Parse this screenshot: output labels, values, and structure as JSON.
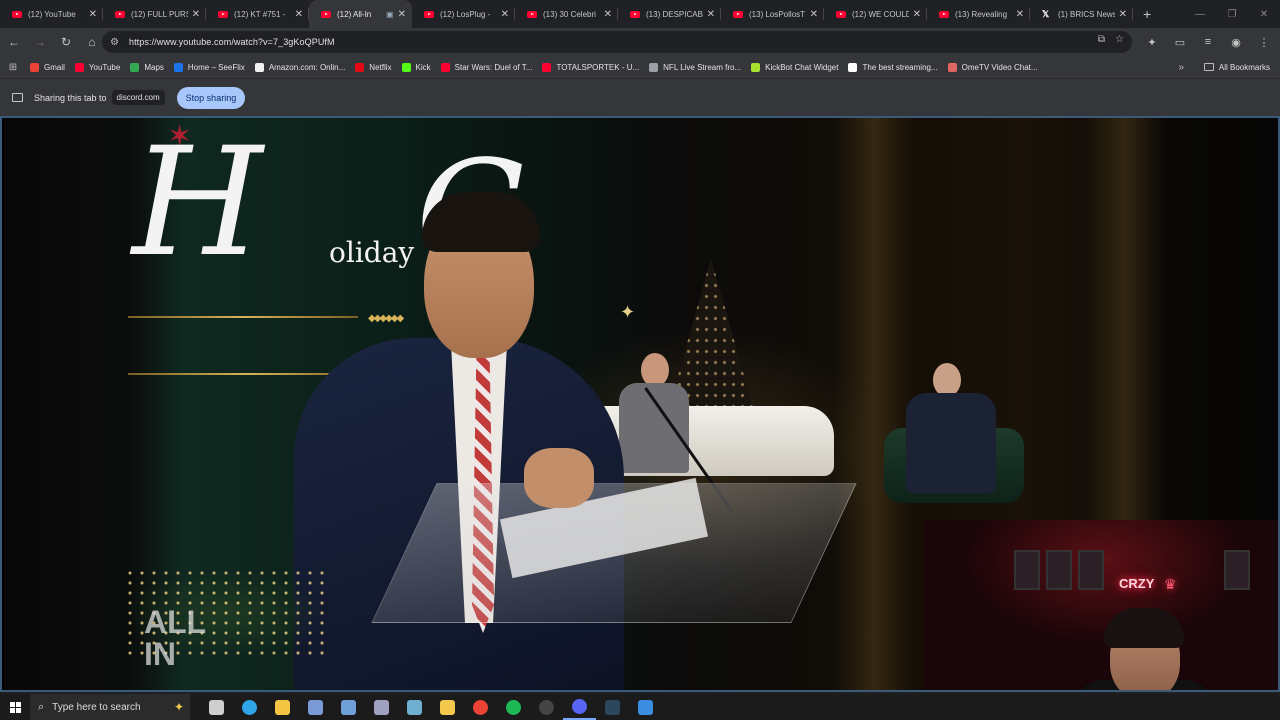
{
  "browser": {
    "tabs": [
      {
        "title": "(12) YouTube",
        "active": false,
        "icon": "youtube-icon"
      },
      {
        "title": "(12) FULL PURS",
        "active": false,
        "icon": "youtube-icon"
      },
      {
        "title": "(12) KT #751 -",
        "active": false,
        "icon": "youtube-icon"
      },
      {
        "title": "(12) All-In",
        "active": true,
        "icon": "youtube-icon"
      },
      {
        "title": "(12) LosPlug -",
        "active": false,
        "icon": "youtube-icon"
      },
      {
        "title": "(13) 30 Celebri",
        "active": false,
        "icon": "youtube-icon"
      },
      {
        "title": "(13) DESPICAB",
        "active": false,
        "icon": "youtube-icon"
      },
      {
        "title": "(13) LosPollosT",
        "active": false,
        "icon": "youtube-icon"
      },
      {
        "title": "(12) WE COULD",
        "active": false,
        "icon": "youtube-icon"
      },
      {
        "title": "(13) Revealing",
        "active": false,
        "icon": "youtube-icon"
      },
      {
        "title": "(1) BRICS News",
        "active": false,
        "icon": "x-icon"
      }
    ],
    "url": "https://www.youtube.com/watch?v=7_3gKoQPUfM"
  },
  "bookmarks": {
    "items": [
      {
        "label": "Gmail",
        "color": "#ea4335"
      },
      {
        "label": "YouTube",
        "color": "#ff0033"
      },
      {
        "label": "Maps",
        "color": "#34a853"
      },
      {
        "label": "Home – SeeFlix",
        "color": "#1a73e8"
      },
      {
        "label": "Amazon.com: Onlin...",
        "color": "#f2f2f2"
      },
      {
        "label": "Netflix",
        "color": "#e50914"
      },
      {
        "label": "Kick",
        "color": "#53fc18"
      },
      {
        "label": "Star Wars: Duel of T...",
        "color": "#ff0033"
      },
      {
        "label": "TOTALSPORTEK - U...",
        "color": "#ff0033"
      },
      {
        "label": "NFL Live Stream fro...",
        "color": "#9aa0a6"
      },
      {
        "label": "KickBot Chat Widget",
        "color": "#a6e22e"
      },
      {
        "label": "The best streaming...",
        "color": "#ffffff"
      },
      {
        "label": "OmeTV Video Chat...",
        "color": "#e06666"
      }
    ],
    "all_label": "All Bookmarks"
  },
  "sharebar": {
    "text": "Sharing this tab to",
    "site": "discord.com",
    "stop_label": "Stop sharing"
  },
  "video": {
    "watermark_line1": "ALL",
    "watermark_line2": "IN",
    "sign_word": "oliday"
  },
  "webcam": {
    "neon_text": "CRZY"
  },
  "taskbar": {
    "search_placeholder": "Type here to search",
    "apps": [
      {
        "name": "task-view-icon",
        "color": "#cfcfcf"
      },
      {
        "name": "edge-icon",
        "color": "#2fa4e7"
      },
      {
        "name": "file-explorer-icon",
        "color": "#f4c542"
      },
      {
        "name": "app-icon-1",
        "color": "#7a9bd6"
      },
      {
        "name": "calculator-icon",
        "color": "#6fa0d8"
      },
      {
        "name": "app-icon-2",
        "color": "#a0a0c0"
      },
      {
        "name": "app-icon-3",
        "color": "#6fb0d0"
      },
      {
        "name": "app-icon-4",
        "color": "#f2c94c"
      },
      {
        "name": "chrome-icon",
        "color": "#ea4335"
      },
      {
        "name": "spotify-icon",
        "color": "#1db954"
      },
      {
        "name": "obs-icon",
        "color": "#444444"
      },
      {
        "name": "discord-icon",
        "color": "#5865f2"
      },
      {
        "name": "steam-icon",
        "color": "#2a475e"
      },
      {
        "name": "app-icon-5",
        "color": "#3b8de0"
      }
    ]
  }
}
